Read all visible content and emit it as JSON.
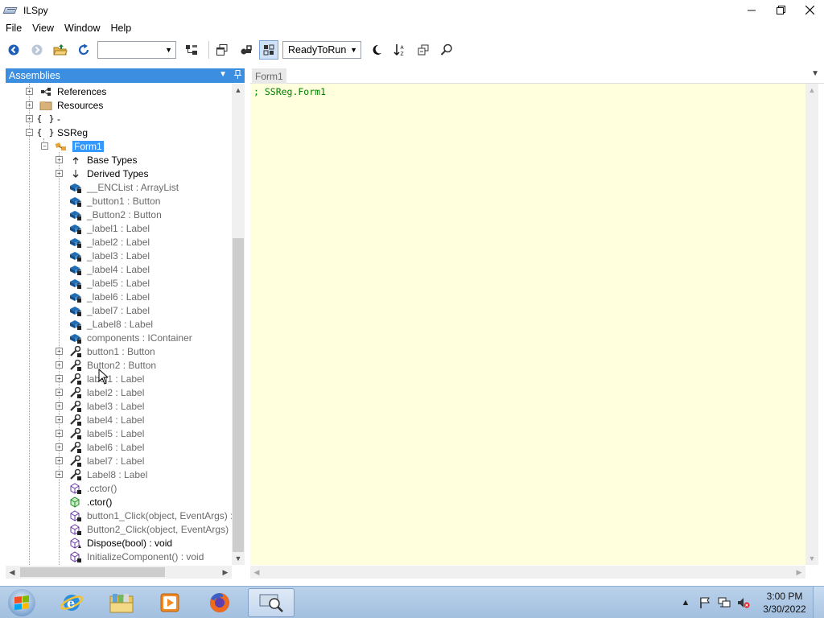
{
  "window": {
    "title": "ILSpy"
  },
  "menu": [
    "File",
    "View",
    "Window",
    "Help"
  ],
  "toolbar": {
    "language_combo_value": "",
    "version_combo_value": "ReadyToRun"
  },
  "left_pane": {
    "header": "Assemblies",
    "tree": [
      {
        "label": "References",
        "icon": "references-icon",
        "expander": "+",
        "indent": 1,
        "style": "normal"
      },
      {
        "label": "Resources",
        "icon": "folder-icon",
        "expander": "+",
        "indent": 1,
        "style": "normal"
      },
      {
        "label": "-",
        "icon": "namespace-icon",
        "expander": "+",
        "indent": 1,
        "style": "normal"
      },
      {
        "label": "SSReg",
        "icon": "namespace-icon",
        "expander": "-",
        "indent": 1,
        "style": "normal"
      },
      {
        "label": "Form1",
        "icon": "class-icon",
        "expander": "-",
        "indent": 2,
        "style": "selected"
      },
      {
        "label": "Base Types",
        "icon": "base-types-icon",
        "expander": "+",
        "indent": 3,
        "style": "normal"
      },
      {
        "label": "Derived Types",
        "icon": "derived-types-icon",
        "expander": "+",
        "indent": 3,
        "style": "normal"
      },
      {
        "label": "__ENCList : ArrayList",
        "icon": "private-field-icon",
        "expander": "",
        "indent": 3,
        "style": "gray"
      },
      {
        "label": "_button1 : Button",
        "icon": "private-field-icon",
        "expander": "",
        "indent": 3,
        "style": "gray"
      },
      {
        "label": "_Button2 : Button",
        "icon": "private-field-icon",
        "expander": "",
        "indent": 3,
        "style": "gray"
      },
      {
        "label": "_label1 : Label",
        "icon": "private-field-icon",
        "expander": "",
        "indent": 3,
        "style": "gray"
      },
      {
        "label": "_label2 : Label",
        "icon": "private-field-icon",
        "expander": "",
        "indent": 3,
        "style": "gray"
      },
      {
        "label": "_label3 : Label",
        "icon": "private-field-icon",
        "expander": "",
        "indent": 3,
        "style": "gray"
      },
      {
        "label": "_label4 : Label",
        "icon": "private-field-icon",
        "expander": "",
        "indent": 3,
        "style": "gray"
      },
      {
        "label": "_label5 : Label",
        "icon": "private-field-icon",
        "expander": "",
        "indent": 3,
        "style": "gray"
      },
      {
        "label": "_label6 : Label",
        "icon": "private-field-icon",
        "expander": "",
        "indent": 3,
        "style": "gray"
      },
      {
        "label": "_label7 : Label",
        "icon": "private-field-icon",
        "expander": "",
        "indent": 3,
        "style": "gray"
      },
      {
        "label": "_Label8 : Label",
        "icon": "private-field-icon",
        "expander": "",
        "indent": 3,
        "style": "gray"
      },
      {
        "label": "components : IContainer",
        "icon": "private-field-icon",
        "expander": "",
        "indent": 3,
        "style": "gray"
      },
      {
        "label": "button1 : Button",
        "icon": "property-icon",
        "expander": "+",
        "indent": 3,
        "style": "gray"
      },
      {
        "label": "Button2 : Button",
        "icon": "property-icon",
        "expander": "+",
        "indent": 3,
        "style": "gray"
      },
      {
        "label": "label1 : Label",
        "icon": "property-icon",
        "expander": "+",
        "indent": 3,
        "style": "gray"
      },
      {
        "label": "label2 : Label",
        "icon": "property-icon",
        "expander": "+",
        "indent": 3,
        "style": "gray"
      },
      {
        "label": "label3 : Label",
        "icon": "property-icon",
        "expander": "+",
        "indent": 3,
        "style": "gray"
      },
      {
        "label": "label4 : Label",
        "icon": "property-icon",
        "expander": "+",
        "indent": 3,
        "style": "gray"
      },
      {
        "label": "label5 : Label",
        "icon": "property-icon",
        "expander": "+",
        "indent": 3,
        "style": "gray"
      },
      {
        "label": "label6 : Label",
        "icon": "property-icon",
        "expander": "+",
        "indent": 3,
        "style": "gray"
      },
      {
        "label": "label7 : Label",
        "icon": "property-icon",
        "expander": "+",
        "indent": 3,
        "style": "gray"
      },
      {
        "label": "Label8 : Label",
        "icon": "property-icon",
        "expander": "+",
        "indent": 3,
        "style": "gray"
      },
      {
        "label": ".cctor()",
        "icon": "private-method-icon",
        "expander": "",
        "indent": 3,
        "style": "gray"
      },
      {
        "label": ".ctor()",
        "icon": "method-icon",
        "expander": "",
        "indent": 3,
        "style": "normal"
      },
      {
        "label": "button1_Click(object, EventArgs) :",
        "icon": "private-method-icon",
        "expander": "",
        "indent": 3,
        "style": "gray"
      },
      {
        "label": "Button2_Click(object, EventArgs) :",
        "icon": "private-method-icon",
        "expander": "",
        "indent": 3,
        "style": "gray"
      },
      {
        "label": "Dispose(bool) : void",
        "icon": "protected-method-icon",
        "expander": "",
        "indent": 3,
        "style": "normal"
      },
      {
        "label": "InitializeComponent() : void",
        "icon": "private-method-icon",
        "expander": "",
        "indent": 3,
        "style": "gray"
      }
    ]
  },
  "right_pane": {
    "tab_label": "Form1",
    "code_line": "; SSReg.Form1"
  },
  "taskbar": {
    "time": "3:00 PM",
    "date": "3/30/2022"
  },
  "colors": {
    "selection": "#3399ff",
    "pane_header": "#3c8ee0",
    "editor_bg": "#fffedd",
    "code_comment": "#008000"
  }
}
